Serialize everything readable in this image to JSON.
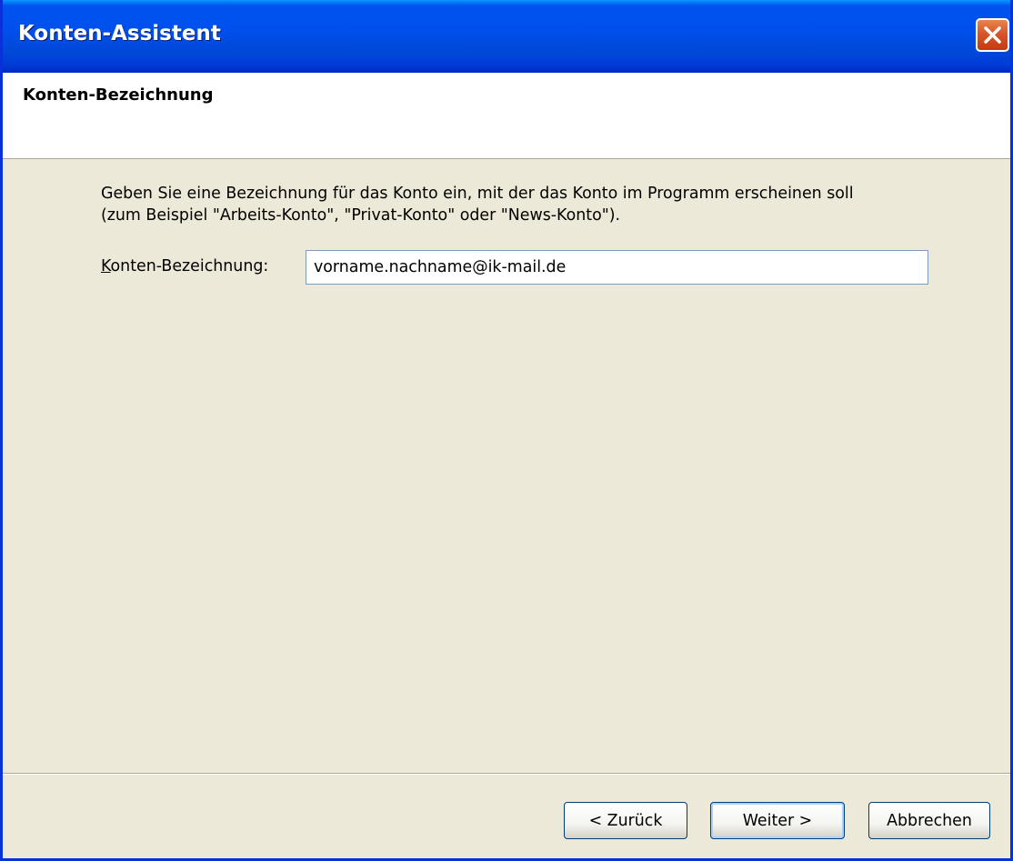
{
  "window": {
    "title": "Konten-Assistent"
  },
  "header": {
    "title": "Konten-Bezeichnung"
  },
  "content": {
    "instruction_line1": "Geben Sie eine Bezeichnung für das Konto ein, mit der das Konto im Programm erscheinen soll",
    "instruction_line2": "(zum Beispiel \"Arbeits-Konto\", \"Privat-Konto\" oder \"News-Konto\").",
    "field_label_accel": "K",
    "field_label_rest": "onten-Bezeichnung:",
    "field_value": "vorname.nachname@ik-mail.de"
  },
  "buttons": {
    "back": "< Zurück",
    "next": "Weiter >",
    "cancel": "Abbrechen"
  },
  "icons": {
    "close": "close-icon"
  },
  "colors": {
    "titlebar": "#0053EE",
    "frame": "#0831D9",
    "dialog_bg": "#ECE9D8",
    "close_button": "#D9552A"
  }
}
